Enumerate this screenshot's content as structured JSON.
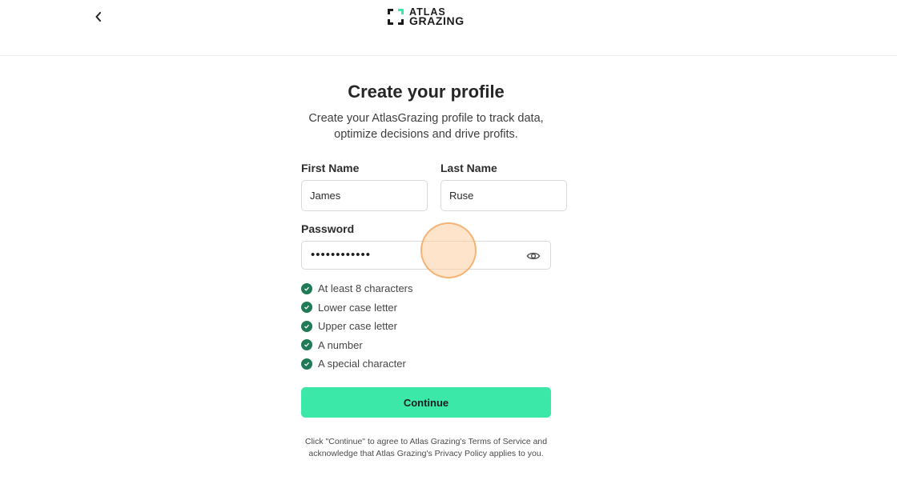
{
  "header": {
    "back_icon": "chevron-left-icon",
    "logo_line1": "ATLAS",
    "logo_line2": "GRAZING"
  },
  "form": {
    "title": "Create your profile",
    "subtitle": "Create your AtlasGrazing profile to track data, optimize decisions and drive profits.",
    "first_name_label": "First Name",
    "first_name_value": "James",
    "last_name_label": "Last Name",
    "last_name_value": "Ruse",
    "password_label": "Password",
    "password_masked": "••••••••••••",
    "password_toggle_icon": "eye-icon",
    "requirements": [
      {
        "label": "At least 8 characters",
        "met": true
      },
      {
        "label": "Lower case letter",
        "met": true
      },
      {
        "label": "Upper case letter",
        "met": true
      },
      {
        "label": "A number",
        "met": true
      },
      {
        "label": "A special character",
        "met": true
      }
    ],
    "continue_label": "Continue",
    "legal_text": "Click \"Continue\" to agree to Atlas Grazing's Terms of Service and acknowledge that Atlas Grazing's Privacy Policy applies to you."
  },
  "colors": {
    "accent": "#3ce8a8",
    "check": "#1f7a57",
    "cursor_highlight": "#fdcea0"
  }
}
